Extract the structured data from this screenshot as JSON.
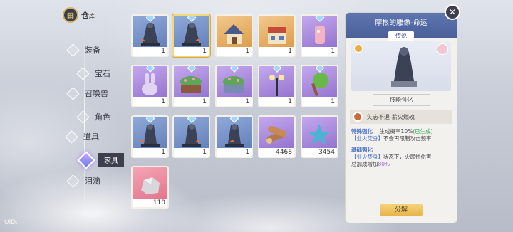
{
  "nav": {
    "title": "仓",
    "title_small": "库",
    "items": [
      {
        "label": "装备"
      },
      {
        "label": "宝石"
      },
      {
        "label": "召唤兽"
      },
      {
        "label": "角色"
      },
      {
        "label": "道具"
      },
      {
        "label": "家具",
        "active": true
      },
      {
        "label": "泪滴"
      }
    ]
  },
  "grid": {
    "items": [
      {
        "name": "statue-1",
        "color": "blue",
        "count": "1",
        "selected": false
      },
      {
        "name": "statue-2",
        "color": "blue",
        "count": "1",
        "selected": true
      },
      {
        "name": "house-1",
        "color": "orange",
        "count": "1"
      },
      {
        "name": "house-2",
        "color": "orange",
        "count": "1"
      },
      {
        "name": "pink-bottle",
        "color": "purple",
        "count": "1"
      },
      {
        "name": "bunny-statue",
        "color": "purple",
        "count": "1"
      },
      {
        "name": "planter-1",
        "color": "purple",
        "count": "1"
      },
      {
        "name": "planter-2",
        "color": "purple",
        "count": "1"
      },
      {
        "name": "street-lamp",
        "color": "purple",
        "count": "1"
      },
      {
        "name": "tree",
        "color": "purple",
        "count": "1"
      },
      {
        "name": "statue-3",
        "color": "blue",
        "count": "1"
      },
      {
        "name": "statue-4",
        "color": "blue",
        "count": "1"
      },
      {
        "name": "statue-5",
        "color": "blue",
        "count": "1"
      },
      {
        "name": "logs",
        "color": "purple",
        "count": "4468"
      },
      {
        "name": "star",
        "color": "purple",
        "count": "3454"
      },
      {
        "name": "rock",
        "color": "pink",
        "count": "110"
      }
    ]
  },
  "panel": {
    "name": "摩根的雕像-命运",
    "rarity": "传说",
    "section_title": "技能强化",
    "skill_text": "矢志不退-薪火燃魂",
    "effect1_title": "特殊强化",
    "effect1_line1": "生成概率10%",
    "effect1_tag": "(已生成)",
    "effect1_line2a": "【业火焚身】",
    "effect1_line2b": "不会再限制攻击频率",
    "effect2_title": "基础强化",
    "effect2_line1a": "【业火焚身】",
    "effect2_line1b": "状态下，火属性伤害",
    "effect2_line2": "总加成增加",
    "effect2_value": "80%",
    "decompose": "分解"
  },
  "close": "✕",
  "uid": "UID:"
}
